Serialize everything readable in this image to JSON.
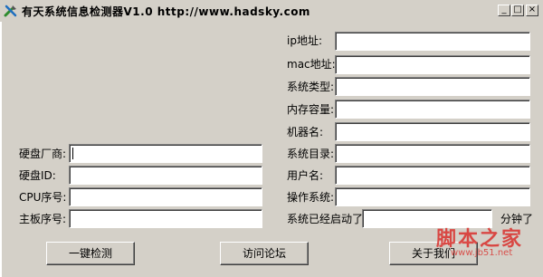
{
  "window": {
    "title": "有天系统信息检测器V1.0  http://www.hadsky.com",
    "controls": {
      "minimize": "_",
      "maximize": "□",
      "close": "×"
    }
  },
  "right_fields": [
    {
      "label": "ip地址:",
      "value": ""
    },
    {
      "label": "mac地址:",
      "value": ""
    },
    {
      "label": "系统类型:",
      "value": ""
    },
    {
      "label": "内存容量:",
      "value": ""
    },
    {
      "label": "机器名:",
      "value": ""
    },
    {
      "label": "系统目录:",
      "value": ""
    },
    {
      "label": "用户名:",
      "value": ""
    },
    {
      "label": "操作系统:",
      "value": ""
    }
  ],
  "uptime": {
    "label": "系统已经启动了",
    "value": "",
    "unit": "分钟了"
  },
  "left_fields": [
    {
      "label": "硬盘厂商:",
      "value": ""
    },
    {
      "label": "硬盘ID:",
      "value": ""
    },
    {
      "label": "CPU序号:",
      "value": ""
    },
    {
      "label": "主板序号:",
      "value": ""
    }
  ],
  "buttons": {
    "detect": "一键检测",
    "forum": "访问论坛",
    "about": "关于我们"
  },
  "watermark": {
    "main": "脚本之家",
    "sub": "www.jb51.net"
  },
  "colors": {
    "face": "#d4d0c8",
    "watermark": "#d9302c"
  }
}
